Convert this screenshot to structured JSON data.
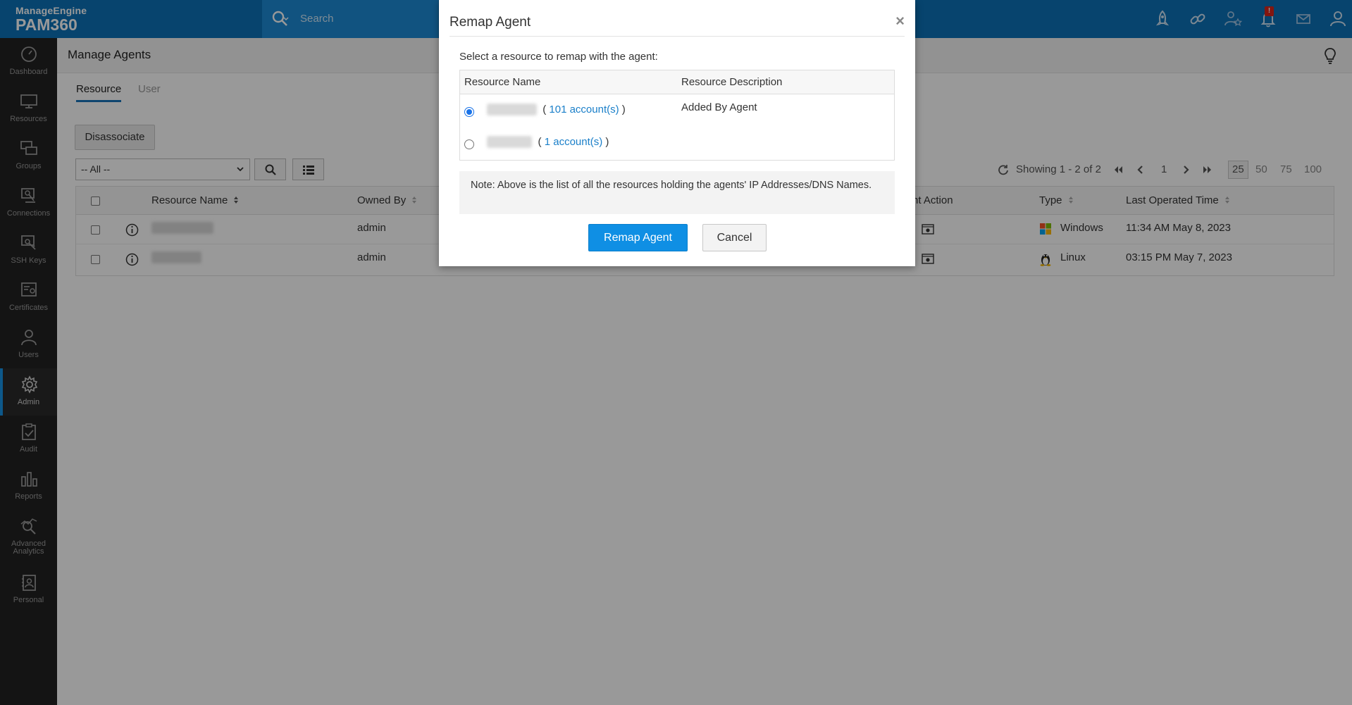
{
  "header": {
    "brand": "ManageEngine",
    "product": "PAM360",
    "search_placeholder": "Search",
    "notification_badge": "!",
    "icons": [
      "rocket-icon",
      "link-icon",
      "star-user-icon",
      "bell-icon",
      "mail-icon",
      "user-icon"
    ],
    "accent_color": "#0d72b8"
  },
  "sidebar": {
    "items": [
      {
        "label": "Dashboard",
        "icon": "dashboard-icon"
      },
      {
        "label": "Resources",
        "icon": "monitor-icon"
      },
      {
        "label": "Groups",
        "icon": "groups-icon"
      },
      {
        "label": "Connections",
        "icon": "connections-icon"
      },
      {
        "label": "SSH Keys",
        "icon": "ssh-keys-icon"
      },
      {
        "label": "Certificates",
        "icon": "certificate-icon"
      },
      {
        "label": "Users",
        "icon": "users-icon"
      },
      {
        "label": "Admin",
        "icon": "gear-icon",
        "active": true
      },
      {
        "label": "Audit",
        "icon": "clipboard-icon"
      },
      {
        "label": "Reports",
        "icon": "bar-chart-icon"
      },
      {
        "label": "Advanced",
        "label2": "Analytics",
        "icon": "analytics-icon"
      },
      {
        "label": "Personal",
        "icon": "personal-icon"
      }
    ]
  },
  "page": {
    "title": "Manage Agents",
    "tabs": [
      {
        "label": "Resource",
        "active": true
      },
      {
        "label": "User",
        "active": false
      }
    ],
    "disassociate_label": "Disassociate",
    "filter_value": "-- All --"
  },
  "pager": {
    "showing": "Showing 1 - 2 of 2",
    "page": "1",
    "sizes": [
      "25",
      "50",
      "75",
      "100"
    ],
    "selected_size": "25"
  },
  "grid": {
    "columns": [
      "Resource Name",
      "Owned By",
      "nt Action",
      "Type",
      "Last Operated Time"
    ],
    "rows": [
      {
        "name": "kanan-13694",
        "owner": "admin",
        "type": "Windows",
        "type_icon": "windows-icon",
        "time": "11:34 AM May 8, 2023"
      },
      {
        "name": "pmp-sent7",
        "owner": "admin",
        "type": "Linux",
        "type_icon": "linux-icon",
        "time": "03:15 PM May 7, 2023"
      }
    ]
  },
  "modal": {
    "title": "Remap Agent",
    "close_symbol": "×",
    "prompt": "Select a resource to remap with the agent:",
    "columns": [
      "Resource Name",
      "Resource Description"
    ],
    "resources": [
      {
        "name": "pmp-sent7",
        "accounts": "101 account(s)",
        "description": "Added By Agent",
        "selected": true
      },
      {
        "name": "linux-chat",
        "accounts": "1 account(s)",
        "description": "",
        "selected": false
      }
    ],
    "note": "Note: Above is the list of all the resources holding the agents' IP Addresses/DNS Names.",
    "remap_label": "Remap Agent",
    "cancel_label": "Cancel",
    "primary_color": "#0f8fe4"
  }
}
